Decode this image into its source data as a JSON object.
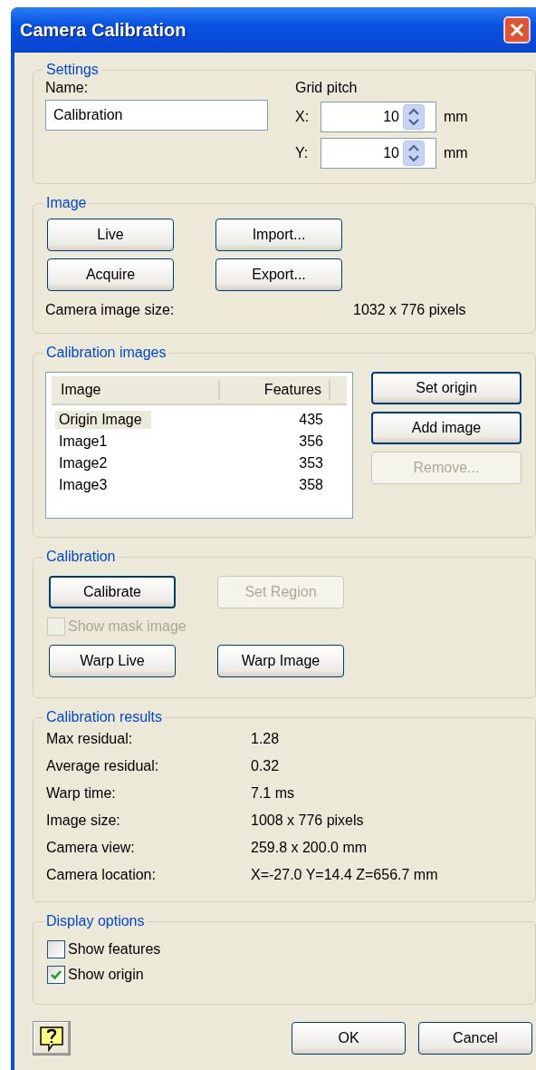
{
  "window": {
    "title": "Camera Calibration"
  },
  "settings": {
    "legend": "Settings",
    "name_label": "Name:",
    "name_value": "Calibration",
    "grid_label": "Grid pitch",
    "axes": [
      {
        "label": "X:",
        "value": "10",
        "unit": "mm"
      },
      {
        "label": "Y:",
        "value": "10",
        "unit": "mm"
      }
    ]
  },
  "image": {
    "legend": "Image",
    "buttons": [
      {
        "label": "Live",
        "disabled": false
      },
      {
        "label": "Import...",
        "disabled": false
      },
      {
        "label": "Acquire",
        "disabled": false
      },
      {
        "label": "Export...",
        "disabled": false
      }
    ],
    "size_label": "Camera image size:",
    "size_value": "1032 x 776 pixels"
  },
  "calibration_images": {
    "legend": "Calibration images",
    "columns": [
      "Image",
      "Features"
    ],
    "rows": [
      {
        "image": "Origin Image",
        "features": "435",
        "selected": true
      },
      {
        "image": "Image1",
        "features": "356",
        "selected": false
      },
      {
        "image": "Image2",
        "features": "353",
        "selected": false
      },
      {
        "image": "Image3",
        "features": "358",
        "selected": false
      }
    ],
    "buttons": [
      {
        "label": "Set origin",
        "disabled": false
      },
      {
        "label": "Add image",
        "disabled": false
      },
      {
        "label": "Remove...",
        "disabled": true
      }
    ]
  },
  "calibration": {
    "legend": "Calibration",
    "buttons": [
      {
        "label": "Calibrate",
        "disabled": false
      },
      {
        "label": "Set Region",
        "disabled": true
      }
    ],
    "show_mask": {
      "label": "Show mask image",
      "checked": false,
      "disabled": true
    },
    "warp_buttons": [
      {
        "label": "Warp Live",
        "disabled": false
      },
      {
        "label": "Warp Image",
        "disabled": false
      }
    ]
  },
  "results": {
    "legend": "Calibration results",
    "rows": [
      {
        "label": "Max residual:",
        "value": "1.28"
      },
      {
        "label": "Average residual:",
        "value": "0.32"
      },
      {
        "label": "Warp time:",
        "value": "7.1 ms"
      },
      {
        "label": "Image size:",
        "value": "1008 x 776 pixels"
      },
      {
        "label": "Camera view:",
        "value": "259.8 x 200.0 mm"
      },
      {
        "label": "Camera location:",
        "value": "X=-27.0 Y=14.4 Z=656.7 mm"
      }
    ]
  },
  "display_options": {
    "legend": "Display options",
    "checkboxes": [
      {
        "label": "Show features",
        "checked": false,
        "disabled": false
      },
      {
        "label": "Show origin",
        "checked": true,
        "disabled": false
      }
    ]
  },
  "footer": {
    "buttons": [
      {
        "label": "OK",
        "disabled": false
      },
      {
        "label": "Cancel",
        "disabled": false
      }
    ]
  }
}
